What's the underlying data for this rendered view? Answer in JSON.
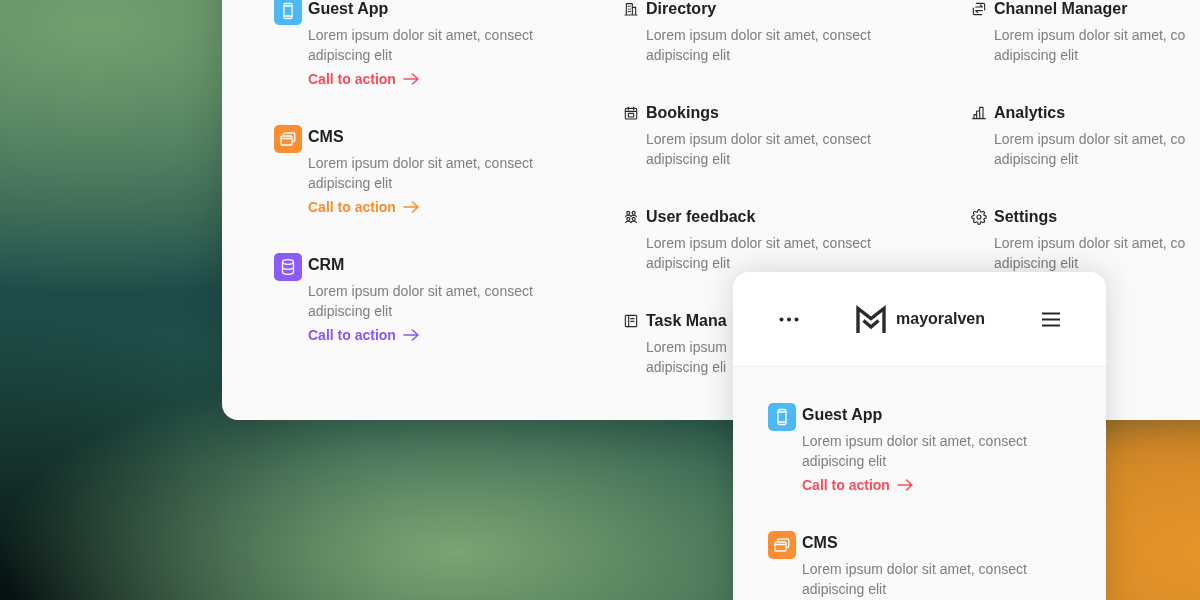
{
  "desktop_menu": {
    "columns": [
      {
        "items": [
          {
            "title": "Guest App",
            "description": [
              "Lorem ipsum dolor sit amet, consect",
              "adipiscing elit"
            ],
            "color": "#4cb8f6",
            "cta": {
              "label": "Call to action",
              "color": "#f4505b"
            }
          },
          {
            "title": "CMS",
            "description": [
              "Lorem ipsum dolor sit amet, consect",
              "adipiscing elit"
            ],
            "color": "#fb8d33",
            "cta": {
              "label": "Call to action",
              "color": "#fa8c2e"
            }
          },
          {
            "title": "CRM",
            "description": [
              "Lorem ipsum dolor sit amet, consect",
              "adipiscing elit"
            ],
            "color": "#8b5cf6",
            "cta": {
              "label": "Call to action",
              "color": "#8a57f3"
            }
          }
        ]
      },
      {
        "items": [
          {
            "title": "Directory",
            "description": [
              "Lorem ipsum dolor sit amet, consect",
              "adipiscing elit"
            ]
          },
          {
            "title": "Bookings",
            "description": [
              "Lorem ipsum dolor sit amet, consect",
              "adipiscing elit"
            ]
          },
          {
            "title": "User feedback",
            "description": [
              "Lorem ipsum dolor sit amet, consect",
              "adipiscing elit"
            ]
          },
          {
            "title": "Task Mana",
            "description": [
              "Lorem ipsum",
              "adipiscing eli"
            ]
          }
        ]
      },
      {
        "items": [
          {
            "title": "Channel Manager",
            "description": [
              "Lorem ipsum dolor sit amet, co",
              "adipiscing elit"
            ]
          },
          {
            "title": "Analytics",
            "description": [
              "Lorem ipsum dolor sit amet, co",
              "adipiscing elit"
            ]
          },
          {
            "title": "Settings",
            "description": [
              "Lorem ipsum dolor sit amet, co",
              "adipiscing elit"
            ]
          }
        ]
      }
    ]
  },
  "mobile_menu": {
    "brand": "mayoralven",
    "items": [
      {
        "title": "Guest App",
        "description": [
          "Lorem ipsum dolor sit amet, consect",
          "adipiscing elit"
        ],
        "color": "#4cb8f6",
        "cta": {
          "label": "Call to action",
          "color": "#f4505b"
        }
      },
      {
        "title": "CMS",
        "description": [
          "Lorem ipsum dolor sit amet, consect",
          "adipiscing elit"
        ],
        "color": "#fb8d33"
      }
    ]
  }
}
